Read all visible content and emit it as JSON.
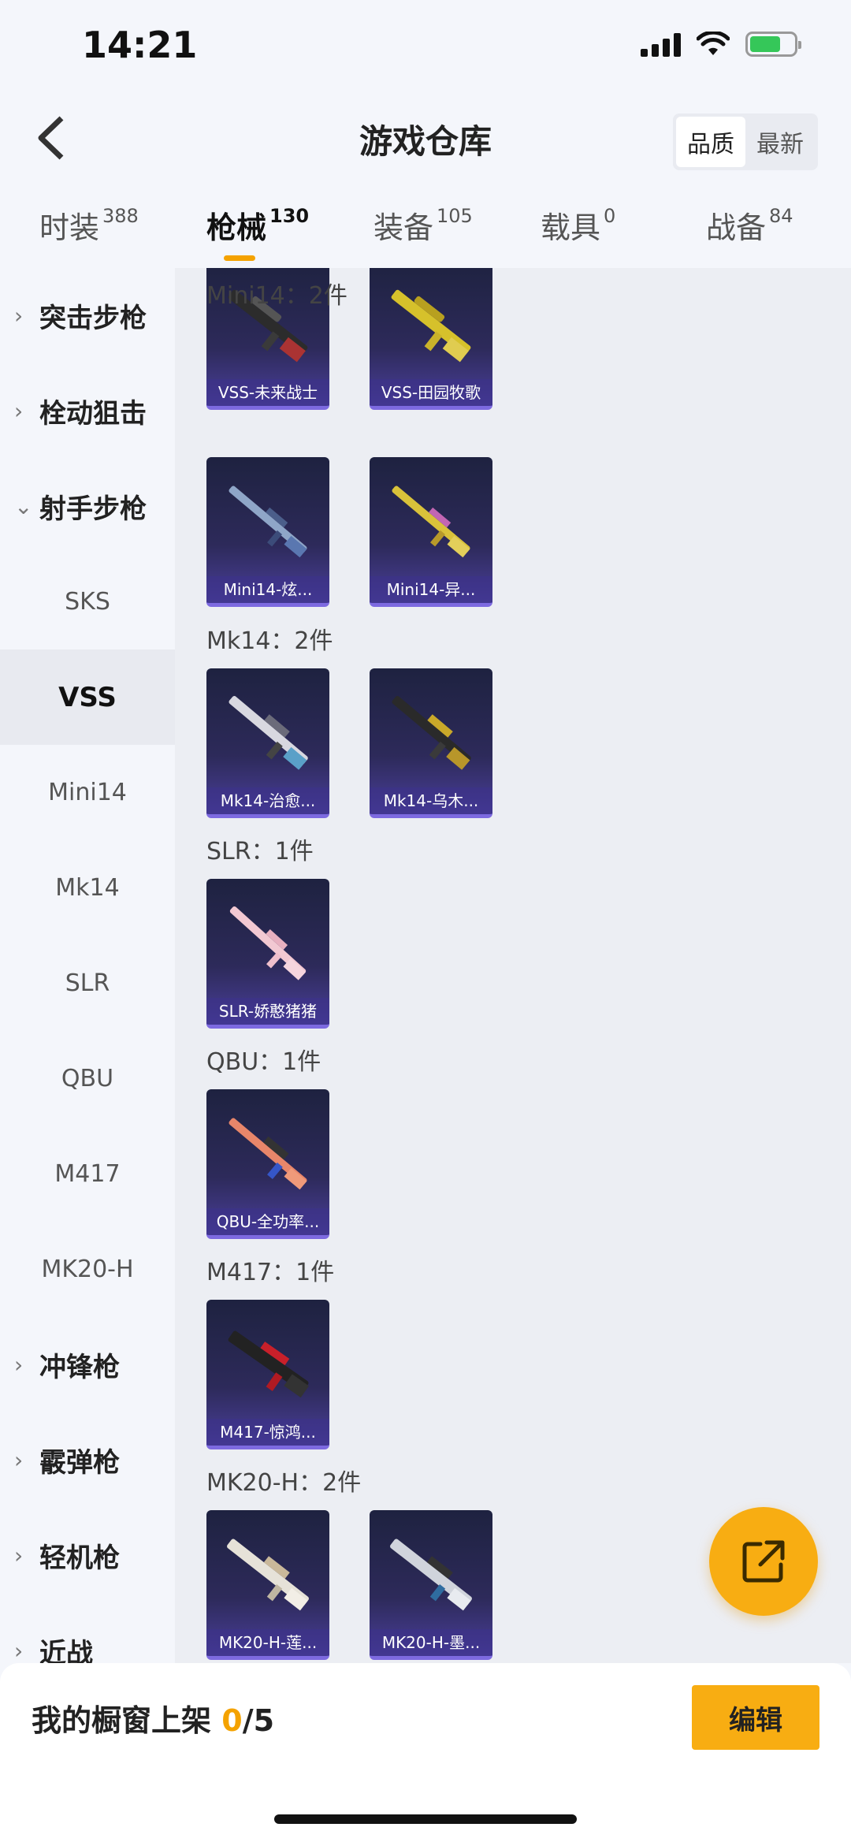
{
  "status": {
    "time": "14:21"
  },
  "header": {
    "title": "游戏仓库",
    "sort_options": [
      "品质",
      "最新"
    ]
  },
  "tabs": [
    {
      "label": "时装",
      "count": "388"
    },
    {
      "label": "枪械",
      "count": "130"
    },
    {
      "label": "装备",
      "count": "105"
    },
    {
      "label": "载具",
      "count": "0"
    },
    {
      "label": "战备",
      "count": "84"
    }
  ],
  "sidebar": {
    "items": [
      {
        "label": "突击步枪",
        "type": "category"
      },
      {
        "label": "栓动狙击",
        "type": "category"
      },
      {
        "label": "射手步枪",
        "type": "category"
      },
      {
        "label": "SKS",
        "type": "sub"
      },
      {
        "label": "VSS",
        "type": "sub"
      },
      {
        "label": "Mini14",
        "type": "sub"
      },
      {
        "label": "Mk14",
        "type": "sub"
      },
      {
        "label": "SLR",
        "type": "sub"
      },
      {
        "label": "QBU",
        "type": "sub"
      },
      {
        "label": "M417",
        "type": "sub"
      },
      {
        "label": "MK20-H",
        "type": "sub"
      },
      {
        "label": "冲锋枪",
        "type": "category"
      },
      {
        "label": "霰弹枪",
        "type": "category"
      },
      {
        "label": "轻机枪",
        "type": "category"
      },
      {
        "label": "近战",
        "type": "category"
      }
    ]
  },
  "groups": [
    {
      "title": "",
      "items": [
        "VSS-未来战士",
        "VSS-田园牧歌"
      ]
    },
    {
      "title": "Mini14：2件",
      "items": [
        "Mini14-炫...",
        "Mini14-异..."
      ]
    },
    {
      "title": "Mk14：2件",
      "items": [
        "Mk14-治愈...",
        "Mk14-乌木..."
      ]
    },
    {
      "title": "SLR：1件",
      "items": [
        "SLR-娇憨猪猪"
      ]
    },
    {
      "title": "QBU：1件",
      "items": [
        "QBU-全功率..."
      ]
    },
    {
      "title": "M417：1件",
      "items": [
        "M417-惊鸿..."
      ]
    },
    {
      "title": "MK20-H：2件",
      "items": [
        "MK20-H-莲...",
        "MK20-H-墨..."
      ]
    }
  ],
  "bottom": {
    "shelf_label": "我的橱窗上架",
    "shelf_count": "0",
    "shelf_total": "/5",
    "edit_label": "编辑"
  },
  "colors": {
    "accent": "#f8ad12",
    "accent_text": "#f4a200",
    "card_bottom": "#7d6ae0"
  }
}
